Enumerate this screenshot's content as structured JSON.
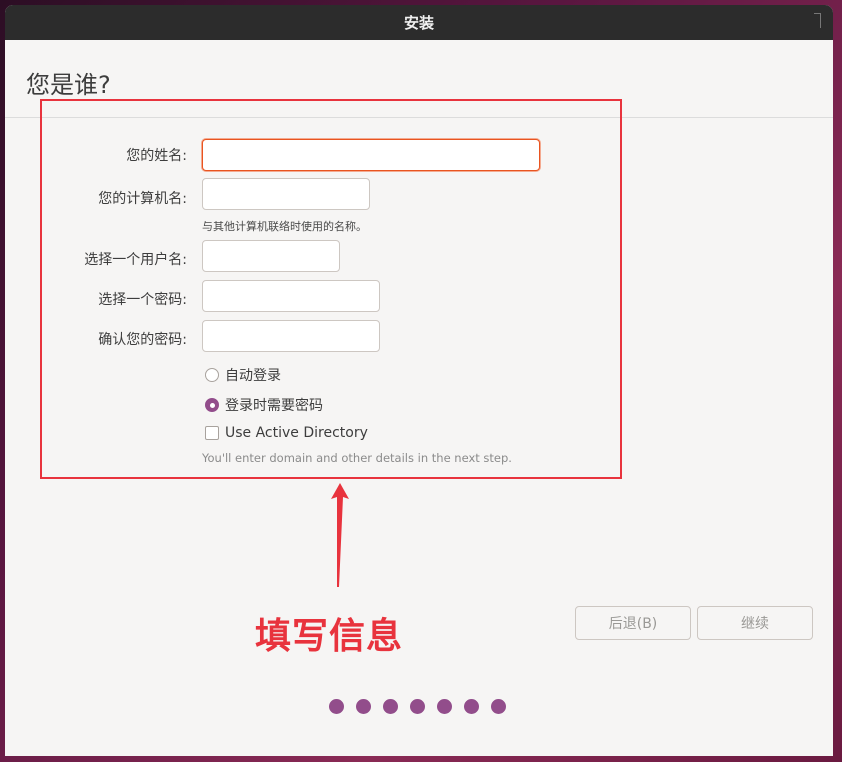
{
  "window": {
    "title": "安装"
  },
  "page": {
    "heading": "您是谁?"
  },
  "form": {
    "name_label": "您的姓名:",
    "name_value": "",
    "computer_label": "您的计算机名:",
    "computer_value": "",
    "computer_hint": "与其他计算机联络时使用的名称。",
    "username_label": "选择一个用户名:",
    "username_value": "",
    "password_label": "选择一个密码:",
    "password_value": "",
    "confirm_label": "确认您的密码:",
    "confirm_value": ""
  },
  "login_options": {
    "auto_login_label": "自动登录",
    "auto_login_checked": false,
    "require_password_label": "登录时需要密码",
    "require_password_checked": true
  },
  "active_directory": {
    "label": "Use Active Directory",
    "checked": false,
    "hint": "You'll enter domain and other details in the next step."
  },
  "annotation": {
    "text": "填写信息",
    "color": "#e8333d"
  },
  "buttons": {
    "back_label": "后退(B)",
    "continue_label": "继续"
  },
  "progress": {
    "total_steps": 7,
    "accent_color": "#924d8b"
  }
}
